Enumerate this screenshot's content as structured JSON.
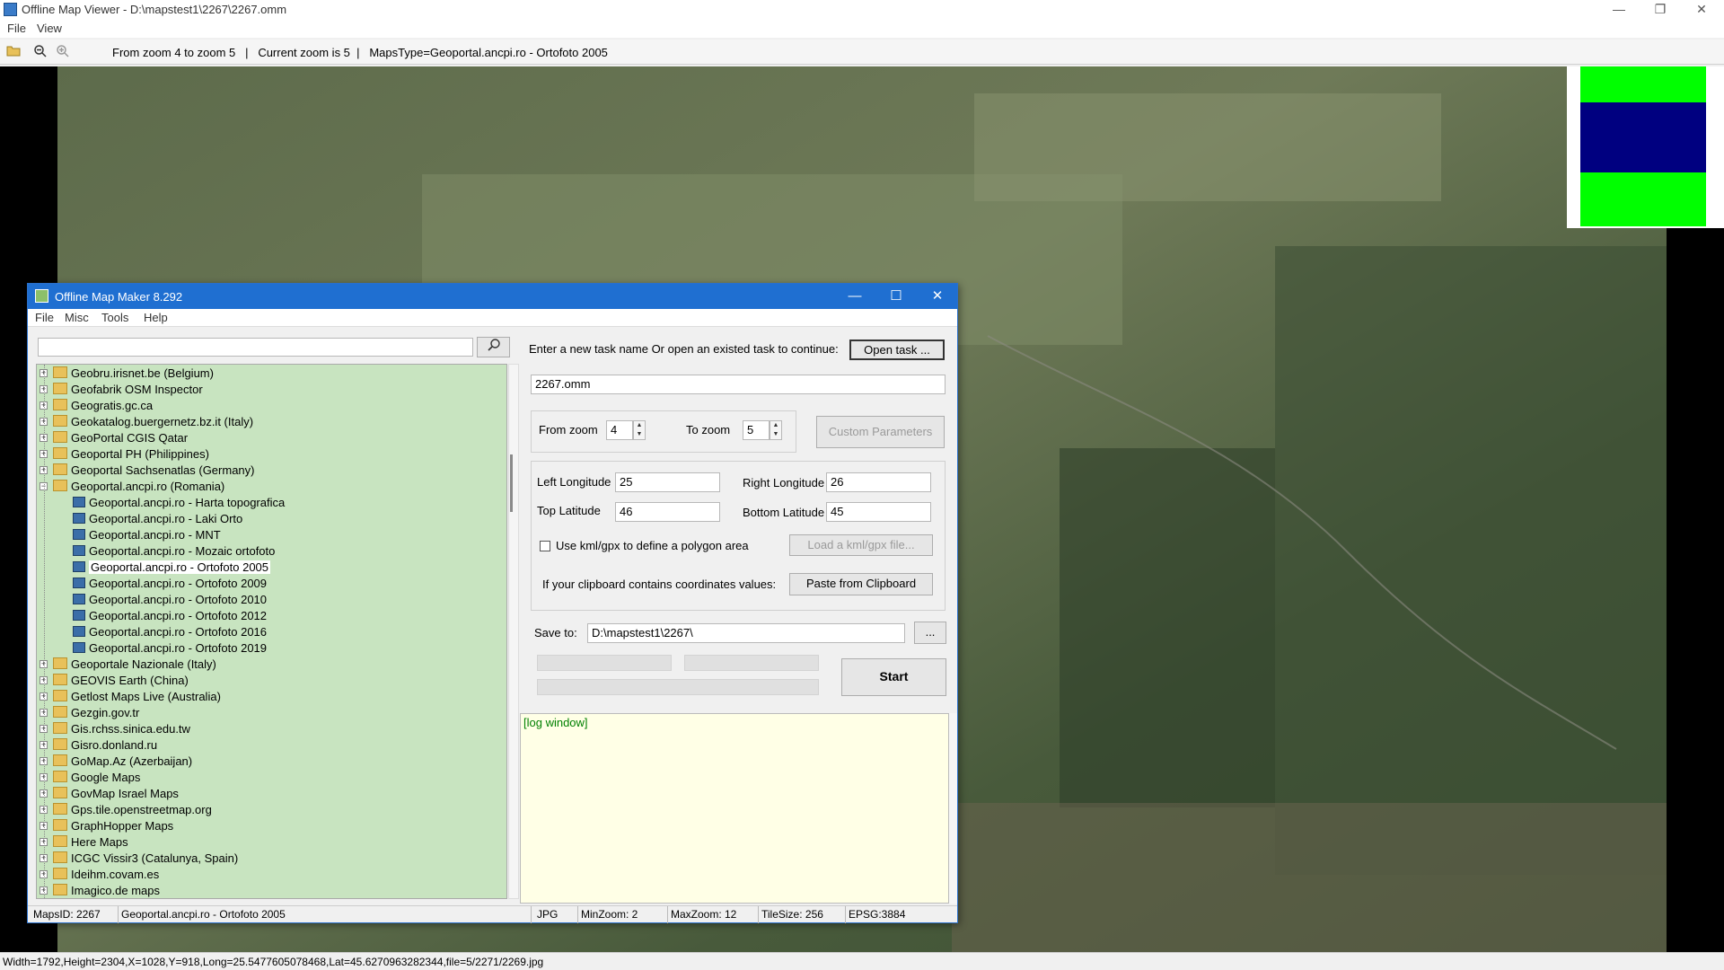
{
  "window": {
    "title": "Offline Map Viewer - D:\\mapstest1\\2267\\2267.omm"
  },
  "menu": [
    "File",
    "View"
  ],
  "toolbar": {
    "info": "From zoom 4 to zoom 5   |   Current zoom is 5  |   MapsType=Geoportal.ancpi.ro - Ortofoto 2005"
  },
  "statusbar": "Width=1792,Height=2304,X=1028,Y=918,Long=25.5477605078468,Lat=45.6270963282344,file=5/2271/2269.jpg",
  "dialog": {
    "title": "Offline Map Maker 8.292",
    "menu": [
      "File",
      "Misc",
      "Tools",
      "Help"
    ],
    "search_value": "",
    "tree": [
      {
        "label": "Geobru.irisnet.be (Belgium)",
        "level": 0,
        "type": "folder"
      },
      {
        "label": "Geofabrik OSM Inspector",
        "level": 0,
        "type": "folder"
      },
      {
        "label": "Geogratis.gc.ca",
        "level": 0,
        "type": "folder"
      },
      {
        "label": "Geokatalog.buergernetz.bz.it (Italy)",
        "level": 0,
        "type": "folder"
      },
      {
        "label": "GeoPortal CGIS Qatar",
        "level": 0,
        "type": "folder"
      },
      {
        "label": "Geoportal PH (Philippines)",
        "level": 0,
        "type": "folder"
      },
      {
        "label": "Geoportal Sachsenatlas (Germany)",
        "level": 0,
        "type": "folder"
      },
      {
        "label": "Geoportal.ancpi.ro (Romania)",
        "level": 0,
        "type": "folder-open"
      },
      {
        "label": "Geoportal.ancpi.ro - Harta topografica",
        "level": 1,
        "type": "map"
      },
      {
        "label": "Geoportal.ancpi.ro - Laki Orto",
        "level": 1,
        "type": "map"
      },
      {
        "label": "Geoportal.ancpi.ro - MNT",
        "level": 1,
        "type": "map"
      },
      {
        "label": "Geoportal.ancpi.ro - Mozaic ortofoto",
        "level": 1,
        "type": "map"
      },
      {
        "label": "Geoportal.ancpi.ro - Ortofoto 2005",
        "level": 1,
        "type": "map",
        "selected": true
      },
      {
        "label": "Geoportal.ancpi.ro - Ortofoto 2009",
        "level": 1,
        "type": "map"
      },
      {
        "label": "Geoportal.ancpi.ro - Ortofoto 2010",
        "level": 1,
        "type": "map"
      },
      {
        "label": "Geoportal.ancpi.ro - Ortofoto 2012",
        "level": 1,
        "type": "map"
      },
      {
        "label": "Geoportal.ancpi.ro - Ortofoto 2016",
        "level": 1,
        "type": "map"
      },
      {
        "label": "Geoportal.ancpi.ro - Ortofoto 2019",
        "level": 1,
        "type": "map"
      },
      {
        "label": "Geoportale Nazionale (Italy)",
        "level": 0,
        "type": "folder"
      },
      {
        "label": "GEOVIS Earth (China)",
        "level": 0,
        "type": "folder"
      },
      {
        "label": "Getlost Maps Live (Australia)",
        "level": 0,
        "type": "folder"
      },
      {
        "label": "Gezgin.gov.tr",
        "level": 0,
        "type": "folder"
      },
      {
        "label": "Gis.rchss.sinica.edu.tw",
        "level": 0,
        "type": "folder"
      },
      {
        "label": "Gisro.donland.ru",
        "level": 0,
        "type": "folder"
      },
      {
        "label": "GoMap.Az (Azerbaijan)",
        "level": 0,
        "type": "folder"
      },
      {
        "label": "Google Maps",
        "level": 0,
        "type": "folder"
      },
      {
        "label": "GovMap Israel Maps",
        "level": 0,
        "type": "folder"
      },
      {
        "label": "Gps.tile.openstreetmap.org",
        "level": 0,
        "type": "folder"
      },
      {
        "label": "GraphHopper Maps",
        "level": 0,
        "type": "folder"
      },
      {
        "label": "Here Maps",
        "level": 0,
        "type": "folder"
      },
      {
        "label": "ICGC Vissir3 (Catalunya, Spain)",
        "level": 0,
        "type": "folder"
      },
      {
        "label": "Ideihm.covam.es",
        "level": 0,
        "type": "folder"
      },
      {
        "label": "Imagico.de maps",
        "level": 0,
        "type": "folder"
      }
    ],
    "task_prompt": "Enter a new task name Or open an existed task to continue:",
    "open_task_label": "Open task ...",
    "task_name": "2267.omm",
    "from_zoom_label": "From zoom",
    "from_zoom": "4",
    "to_zoom_label": "To zoom",
    "to_zoom": "5",
    "custom_params_label": "Custom Parameters",
    "left_lon_label": "Left Longitude",
    "left_lon": "25",
    "right_lon_label": "Right Longitude",
    "right_lon": "26",
    "top_lat_label": "Top Latitude",
    "top_lat": "46",
    "bottom_lat_label": "Bottom Latitude",
    "bottom_lat": "45",
    "kml_label": "Use kml/gpx to define a polygon area",
    "load_kml_label": "Load a kml/gpx file...",
    "clipboard_label": "If your clipboard contains coordinates values:",
    "paste_label": "Paste from Clipboard",
    "save_to_label": "Save to:",
    "save_path": "D:\\mapstest1\\2267\\",
    "browse_label": "...",
    "start_label": "Start",
    "log_label": "[log window]",
    "status": {
      "maps_id": "MapsID: 2267",
      "maps_name": "Geoportal.ancpi.ro - Ortofoto 2005",
      "format": "JPG",
      "min_zoom": "MinZoom: 2",
      "max_zoom": "MaxZoom: 12",
      "tile_size": "TileSize: 256",
      "epsg": "EPSG:3884"
    }
  },
  "colors": {
    "tree_bg": "#c8e4c0",
    "caption": "#1f6fd1",
    "log_bg": "#ffffe6",
    "legend_green": "#00ff00",
    "legend_blue": "#000080"
  }
}
